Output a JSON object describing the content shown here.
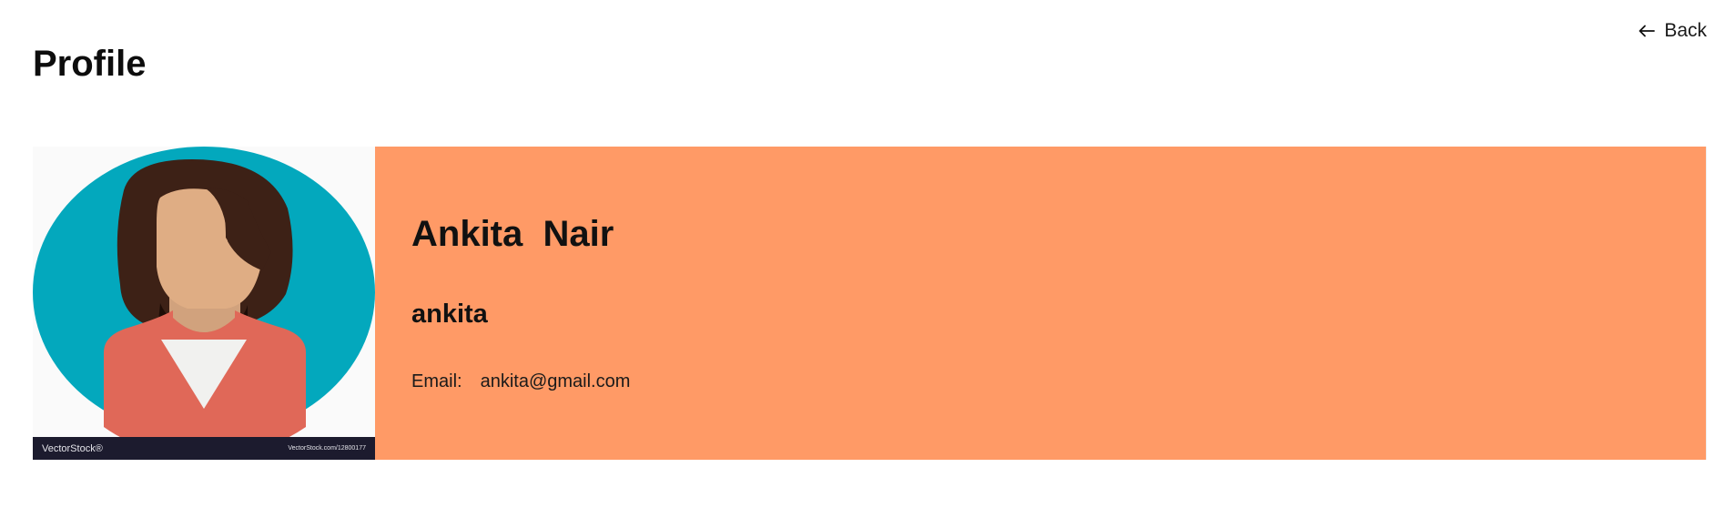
{
  "header": {
    "title": "Profile",
    "back_label": "Back",
    "back_icon": "arrow-left-icon"
  },
  "profile": {
    "full_name": "Ankita  Nair",
    "username": "ankita",
    "email_label": "Email:",
    "email_value": "ankita@gmail.com",
    "avatar_icon": "female-avatar-illustration",
    "watermark_brand": "VectorStock®",
    "watermark_url": "VectorStock.com/12800177"
  },
  "colors": {
    "info_panel_bg": "#ff9a66",
    "avatar_circle": "#03a8bd",
    "hair": "#3d2116",
    "skin": "#dfad84",
    "shirt": "#e06858",
    "watermark_bar": "#1c1b2e"
  }
}
